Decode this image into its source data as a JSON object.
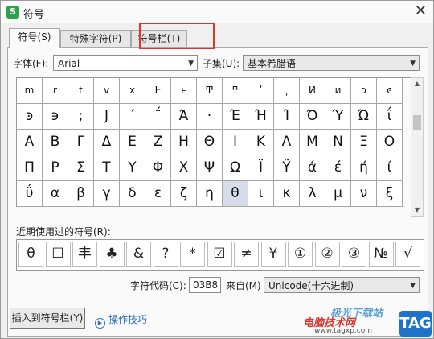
{
  "window": {
    "title": "符号",
    "app_icon": "S"
  },
  "tabs": [
    {
      "label": "符号(S)",
      "active": true
    },
    {
      "label": "特殊字符(P)",
      "active": false
    },
    {
      "label": "符号栏(T)",
      "active": false
    }
  ],
  "font": {
    "label": "字体(F):",
    "value": "Arial"
  },
  "subset": {
    "label": "子集(U):",
    "value": "基本希腊语"
  },
  "symbol_rows": [
    [
      "m",
      "r",
      "t",
      "v",
      "x",
      "Ͱ",
      "ͱ",
      "Ͳ",
      "ͳ",
      "ʹ",
      "͵",
      "Ͷ",
      "ͷ",
      "ͻ",
      "ͼ"
    ],
    [
      "ͽ",
      "϶",
      ";",
      "Ϳ",
      "΄",
      "΅",
      "Ά",
      "·",
      "Έ",
      "Ή",
      "Ί",
      "Ό",
      "Ύ",
      "Ώ",
      "ΐ"
    ],
    [
      "Α",
      "Β",
      "Γ",
      "Δ",
      "Ε",
      "Ζ",
      "Η",
      "Θ",
      "Ι",
      "Κ",
      "Λ",
      "Μ",
      "Ν",
      "Ξ",
      "Ο"
    ],
    [
      "Π",
      "Ρ",
      "Σ",
      "Τ",
      "Υ",
      "Φ",
      "Χ",
      "Ψ",
      "Ω",
      "Ϊ",
      "Ϋ",
      "ά",
      "έ",
      "ή",
      "ί"
    ],
    [
      "ΰ",
      "α",
      "β",
      "γ",
      "δ",
      "ε",
      "ζ",
      "η",
      "θ",
      "ι",
      "κ",
      "λ",
      "μ",
      "ν",
      "ξ"
    ]
  ],
  "recent": {
    "label": "近期使用过的符号(R):",
    "symbols": [
      "θ",
      "☐",
      "丰",
      "♣",
      "&",
      "?",
      "*",
      "☑",
      "≠",
      "¥",
      "①",
      "②",
      "③",
      "№",
      "√"
    ]
  },
  "char_code": {
    "label": "字符代码(C):",
    "value": "03B8"
  },
  "from": {
    "label": "来自(M)",
    "value": "Unicode(十六进制)"
  },
  "buttons": {
    "insert_to_bar": "插入到符号栏(Y)",
    "tips": "操作技巧"
  },
  "watermark": {
    "line1": "极光下载站",
    "line2": "电脑技术网",
    "url": "www.tagxp.com",
    "tag": "TAG"
  },
  "colors": {
    "accent_red": "#e0352b",
    "link_blue": "#2f6fb6",
    "selected_cell": "#d6dde8"
  }
}
